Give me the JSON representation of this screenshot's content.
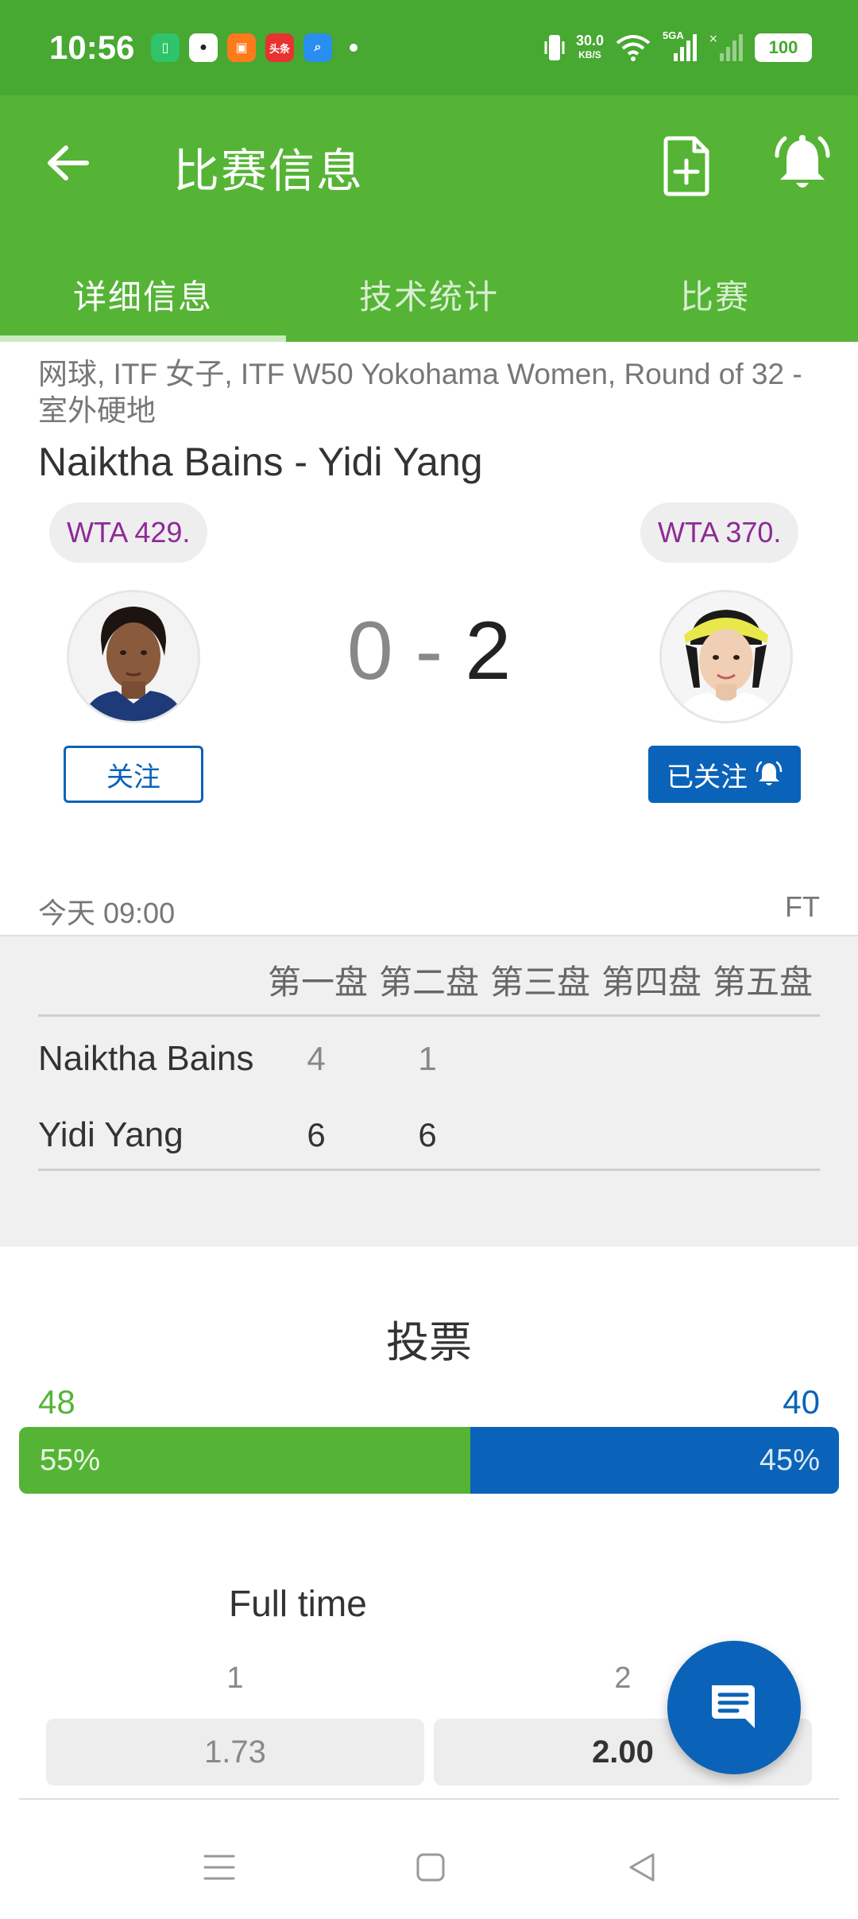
{
  "status_bar": {
    "time": "10:56",
    "net_speed_value": "30.0",
    "net_speed_unit": "KB/S",
    "network_type": "5GA",
    "battery": "100",
    "app_icons": [
      "battery-saver-app-icon",
      "qq-app-icon",
      "orange-app-icon",
      "toutiao-app-icon",
      "search-app-icon"
    ],
    "toutiao_label": "头条"
  },
  "app_bar": {
    "title": "比赛信息",
    "tabs": [
      {
        "label": "详细信息",
        "active": true
      },
      {
        "label": "技术统计",
        "active": false
      },
      {
        "label": "比赛",
        "active": false
      }
    ]
  },
  "match": {
    "league": "网球, ITF 女子, ITF W50 Yokohama Women, Round of 32 - 室外硬地",
    "name": "Naiktha Bains - Yidi Yang",
    "home": {
      "rank": "WTA 429.",
      "follow_label": "关注"
    },
    "away": {
      "rank": "WTA 370.",
      "follow_label": "已关注"
    },
    "score_home": "0",
    "score_sep": "-",
    "score_away": "2",
    "datetime": "今天 09:00",
    "status": "FT"
  },
  "sets": {
    "headers": [
      "第一盘",
      "第二盘",
      "第三盘",
      "第四盘",
      "第五盘"
    ],
    "rows": [
      {
        "player": "Naiktha Bains",
        "scores": [
          "4",
          "1"
        ]
      },
      {
        "player": "Yidi Yang",
        "scores": [
          "6",
          "6"
        ]
      }
    ]
  },
  "vote": {
    "title": "投票",
    "home_count": "48",
    "away_count": "40",
    "home_pct_label": "55%",
    "away_pct_label": "45%",
    "home_pct": 55,
    "away_pct": 45
  },
  "odds": {
    "title": "Full time",
    "labels": [
      "1",
      "2"
    ],
    "values": [
      "1.73",
      "2.00"
    ]
  },
  "colors": {
    "brand_green": "#55b435",
    "status_green": "#47a832",
    "accent_blue": "#0a63b8",
    "rank_purple": "#8e2a96"
  }
}
